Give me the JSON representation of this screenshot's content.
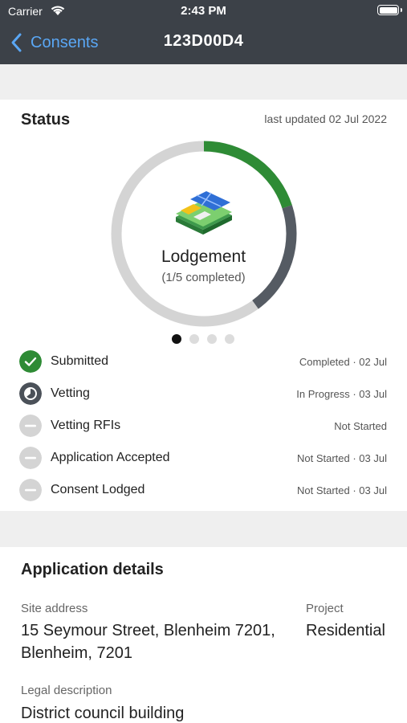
{
  "status_bar": {
    "carrier": "Carrier",
    "time": "2:43 PM"
  },
  "nav": {
    "back_label": "Consents",
    "title": "123D00D4"
  },
  "status": {
    "heading": "Status",
    "last_updated": "last updated 02 Jul 2022",
    "stage_name": "Lodgement",
    "stage_progress": "(1/5 completed)",
    "completed_fraction": 0.2,
    "in_progress_fraction": 0.2,
    "page_count": 4,
    "current_page": 1,
    "colors": {
      "completed": "#2e8b35",
      "in_progress": "#555b63",
      "not_started": "#d4d4d4"
    },
    "steps": [
      {
        "name": "Submitted",
        "meta": "Completed · 02 Jul",
        "state": "completed",
        "icon": "check-circle-icon"
      },
      {
        "name": "Vetting",
        "meta": "In Progress · 03 Jul",
        "state": "in-progress",
        "icon": "clock-circle-icon"
      },
      {
        "name": "Vetting RFIs",
        "meta": "Not Started",
        "state": "not-started",
        "icon": "minus-circle-icon"
      },
      {
        "name": "Application Accepted",
        "meta": "Not Started · 03 Jul",
        "state": "not-started",
        "icon": "minus-circle-icon"
      },
      {
        "name": "Consent Lodged",
        "meta": "Not Started · 03 Jul",
        "state": "not-started",
        "icon": "minus-circle-icon"
      }
    ]
  },
  "details": {
    "heading": "Application details",
    "site_address_label": "Site address",
    "site_address_line1": "15 Seymour Street, Blenheim 7201,",
    "site_address_line2": "Blenheim, 7201",
    "project_label": "Project",
    "project_value": "Residential",
    "legal_label": "Legal description",
    "legal_value": "District council building"
  }
}
